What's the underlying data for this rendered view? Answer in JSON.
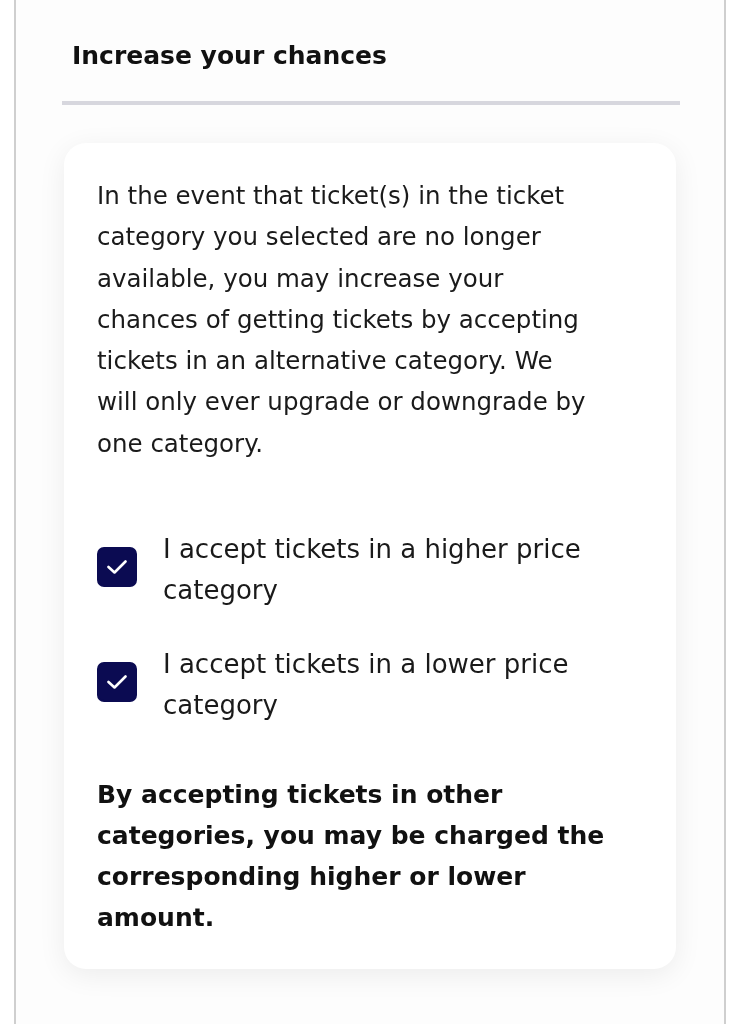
{
  "section": {
    "title": "Increase your chances"
  },
  "card": {
    "description": "In the event that ticket(s) in the ticket category you selected are no longer available, you may increase your chances of getting tickets by accepting tickets in an alternative category. We will only ever upgrade or downgrade by one category.",
    "options": [
      {
        "label": "I accept tickets in a higher price category",
        "checked": true
      },
      {
        "label": "I accept tickets in a lower price category",
        "checked": true
      }
    ],
    "notice": "By accepting tickets in other categories, you may be charged the corresponding higher or lower amount."
  }
}
